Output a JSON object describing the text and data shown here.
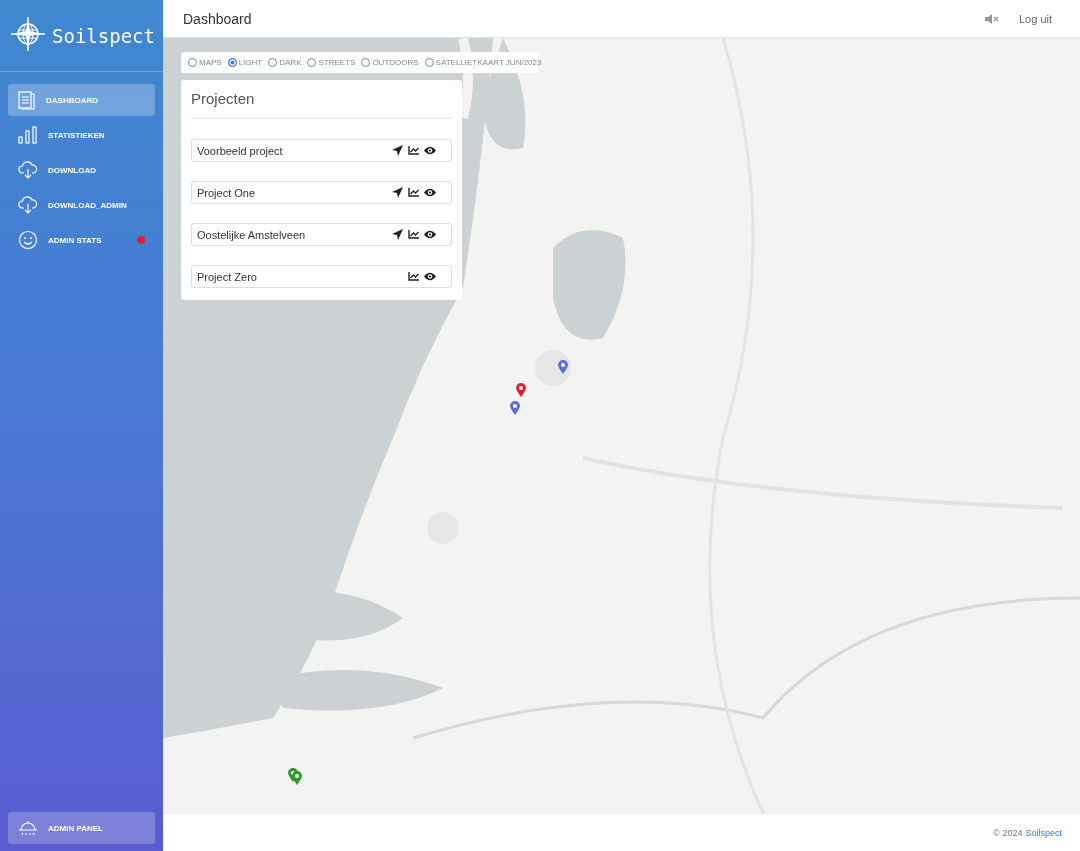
{
  "sidebar": {
    "brand": "Soilspect",
    "items": [
      {
        "label": "DASHBOARD",
        "selected": true,
        "notification": false
      },
      {
        "label": "STATISTIEKEN",
        "selected": false,
        "notification": false
      },
      {
        "label": "DOWNLOAD",
        "selected": false,
        "notification": false
      },
      {
        "label": "DOWNLOAD_ADMIN",
        "selected": false,
        "notification": false
      },
      {
        "label": "ADMIN STATS",
        "selected": false,
        "notification": true
      }
    ],
    "footer_item": {
      "label": "ADMIN PANEL",
      "selected": false
    }
  },
  "header": {
    "title": "Dashboard",
    "muted": true,
    "logout": "Log uit"
  },
  "map": {
    "layers": [
      {
        "label": "MAPS",
        "selected": false
      },
      {
        "label": "LIGHT",
        "selected": true
      },
      {
        "label": "DARK",
        "selected": false
      },
      {
        "label": "STREETS",
        "selected": false
      },
      {
        "label": "OUTDOORS",
        "selected": false
      },
      {
        "label": "SATELLIETKAART JUN/2023",
        "selected": false
      }
    ],
    "markers": [
      {
        "color": "#5b6ee0"
      },
      {
        "color": "#e0202c"
      },
      {
        "color": "#5b6ee0"
      },
      {
        "color": "#2e9a2e"
      },
      {
        "color": "#2e9a2e"
      }
    ]
  },
  "projects": {
    "title": "Projecten",
    "items": [
      {
        "name": "Voorbeeld project",
        "locatable": true
      },
      {
        "name": "Project One",
        "locatable": true
      },
      {
        "name": "Oostelijke Amstelveen",
        "locatable": true
      },
      {
        "name": "Project Zero",
        "locatable": false
      }
    ]
  },
  "footer": {
    "copyright": "© 2024",
    "link": "Soilspect"
  }
}
